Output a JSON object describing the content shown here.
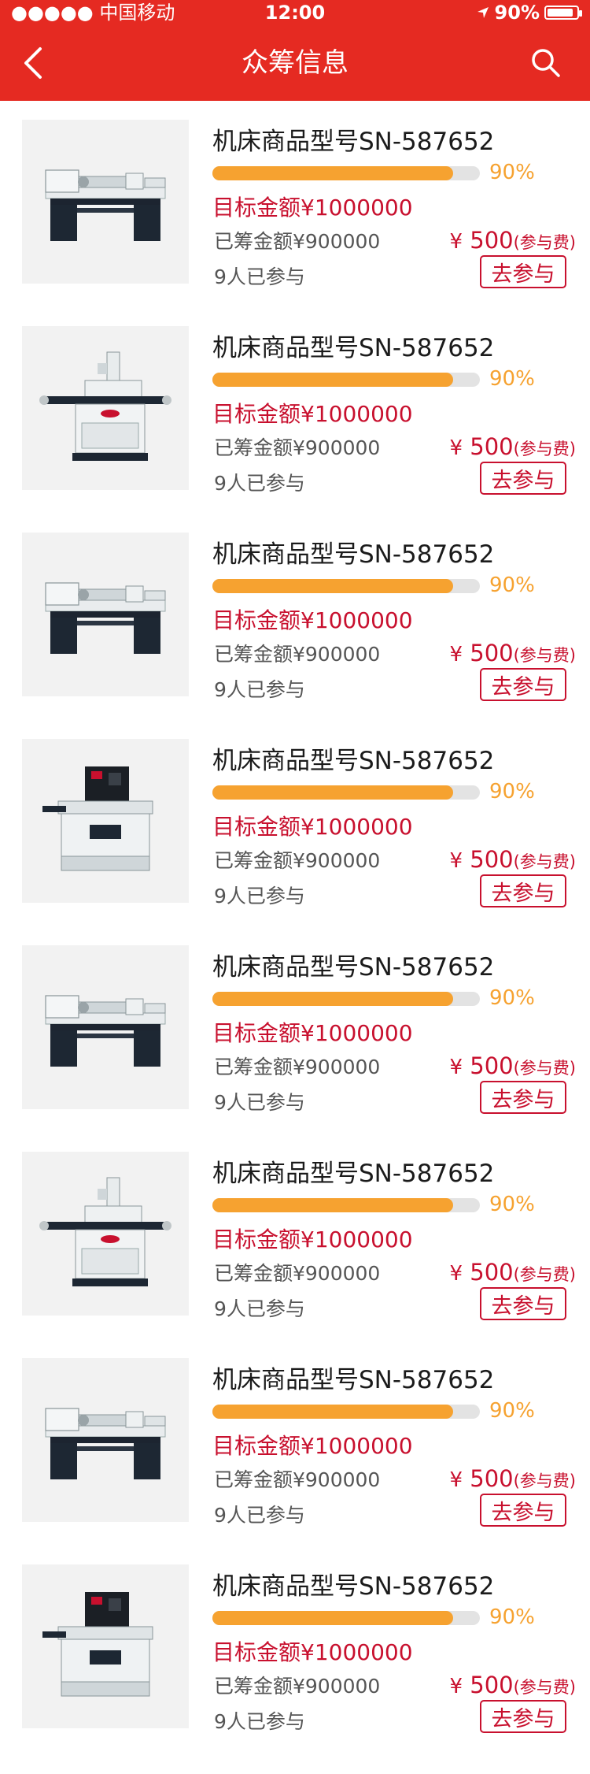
{
  "status_bar": {
    "signal": "●●●●●",
    "carrier": "中国移动",
    "time": "12:00",
    "battery": "90%",
    "battery_level": 0.9
  },
  "nav": {
    "title": "众筹信息"
  },
  "items": [
    {
      "title": "机床商品型号SN-587652",
      "progress_pct": 90,
      "progress_text": "90%",
      "target": "目标金额¥1000000",
      "raised": "已筹金额¥900000",
      "participants": "9人已参与",
      "fee_currency": "¥",
      "fee_amount": " 500",
      "fee_note": "(参与费)",
      "join": "去参与",
      "image": "lathe-machine-icon"
    },
    {
      "title": "机床商品型号SN-587652",
      "progress_pct": 90,
      "progress_text": "90%",
      "target": "目标金额¥1000000",
      "raised": "已筹金额¥900000",
      "participants": "9人已参与",
      "fee_currency": "¥",
      "fee_amount": " 500",
      "fee_note": "(参与费)",
      "join": "去参与",
      "image": "milling-machine-icon"
    },
    {
      "title": "机床商品型号SN-587652",
      "progress_pct": 90,
      "progress_text": "90%",
      "target": "目标金额¥1000000",
      "raised": "已筹金额¥900000",
      "participants": "9人已参与",
      "fee_currency": "¥",
      "fee_amount": " 500",
      "fee_note": "(参与费)",
      "join": "去参与",
      "image": "lathe-machine-icon"
    },
    {
      "title": "机床商品型号SN-587652",
      "progress_pct": 90,
      "progress_text": "90%",
      "target": "目标金额¥1000000",
      "raised": "已筹金额¥900000",
      "participants": "9人已参与",
      "fee_currency": "¥",
      "fee_amount": " 500",
      "fee_note": "(参与费)",
      "join": "去参与",
      "image": "edm-machine-icon"
    },
    {
      "title": "机床商品型号SN-587652",
      "progress_pct": 90,
      "progress_text": "90%",
      "target": "目标金额¥1000000",
      "raised": "已筹金额¥900000",
      "participants": "9人已参与",
      "fee_currency": "¥",
      "fee_amount": " 500",
      "fee_note": "(参与费)",
      "join": "去参与",
      "image": "lathe-machine-icon"
    },
    {
      "title": "机床商品型号SN-587652",
      "progress_pct": 90,
      "progress_text": "90%",
      "target": "目标金额¥1000000",
      "raised": "已筹金额¥900000",
      "participants": "9人已参与",
      "fee_currency": "¥",
      "fee_amount": " 500",
      "fee_note": "(参与费)",
      "join": "去参与",
      "image": "milling-machine-icon"
    },
    {
      "title": "机床商品型号SN-587652",
      "progress_pct": 90,
      "progress_text": "90%",
      "target": "目标金额¥1000000",
      "raised": "已筹金额¥900000",
      "participants": "9人已参与",
      "fee_currency": "¥",
      "fee_amount": " 500",
      "fee_note": "(参与费)",
      "join": "去参与",
      "image": "lathe-machine-icon"
    },
    {
      "title": "机床商品型号SN-587652",
      "progress_pct": 90,
      "progress_text": "90%",
      "target": "目标金额¥1000000",
      "raised": "已筹金额¥900000",
      "participants": "9人已参与",
      "fee_currency": "¥",
      "fee_amount": " 500",
      "fee_note": "(参与费)",
      "join": "去参与",
      "image": "edm-machine-icon"
    }
  ],
  "colors": {
    "header": "#e52a22",
    "accent_red": "#c8102e",
    "progress": "#f6a230",
    "progress_track": "#e3e3e3",
    "thumb_bg": "#f2f2f2"
  }
}
